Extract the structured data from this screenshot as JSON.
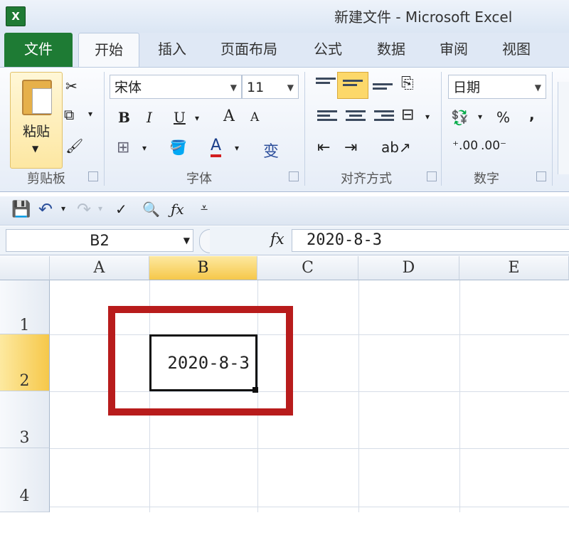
{
  "window": {
    "title": "新建文件 - Microsoft Excel",
    "app_icon_letter": "X"
  },
  "tabs": [
    {
      "label": "文件"
    },
    {
      "label": "开始"
    },
    {
      "label": "插入"
    },
    {
      "label": "页面布局"
    },
    {
      "label": "公式"
    },
    {
      "label": "数据"
    },
    {
      "label": "审阅"
    },
    {
      "label": "视图"
    }
  ],
  "ribbon": {
    "clipboard": {
      "paste_label": "粘贴",
      "group_label": "剪贴板"
    },
    "font": {
      "font_name": "宋体",
      "font_size": "11",
      "bold": "B",
      "italic": "I",
      "underline": "U",
      "grow": "A",
      "shrink": "A",
      "font_color_glyph": "A",
      "phonetic_glyph": "变",
      "group_label": "字体"
    },
    "alignment": {
      "group_label": "对齐方式"
    },
    "number": {
      "format": "日期",
      "percent": "%",
      "comma": ",",
      "group_label": "数字"
    }
  },
  "formula_bar": {
    "name_box": "B2",
    "fx": "fx",
    "value": "2020-8-3"
  },
  "grid": {
    "columns": [
      "A",
      "B",
      "C",
      "D",
      "E"
    ],
    "rows": [
      "1",
      "2",
      "3",
      "4"
    ],
    "selected_cell": "B2",
    "cell_b2": "2020-8-3"
  },
  "colors": {
    "file_tab": "#1e7b34",
    "selection_header": "#f6c84a",
    "highlight_box": "#b81c1c"
  }
}
